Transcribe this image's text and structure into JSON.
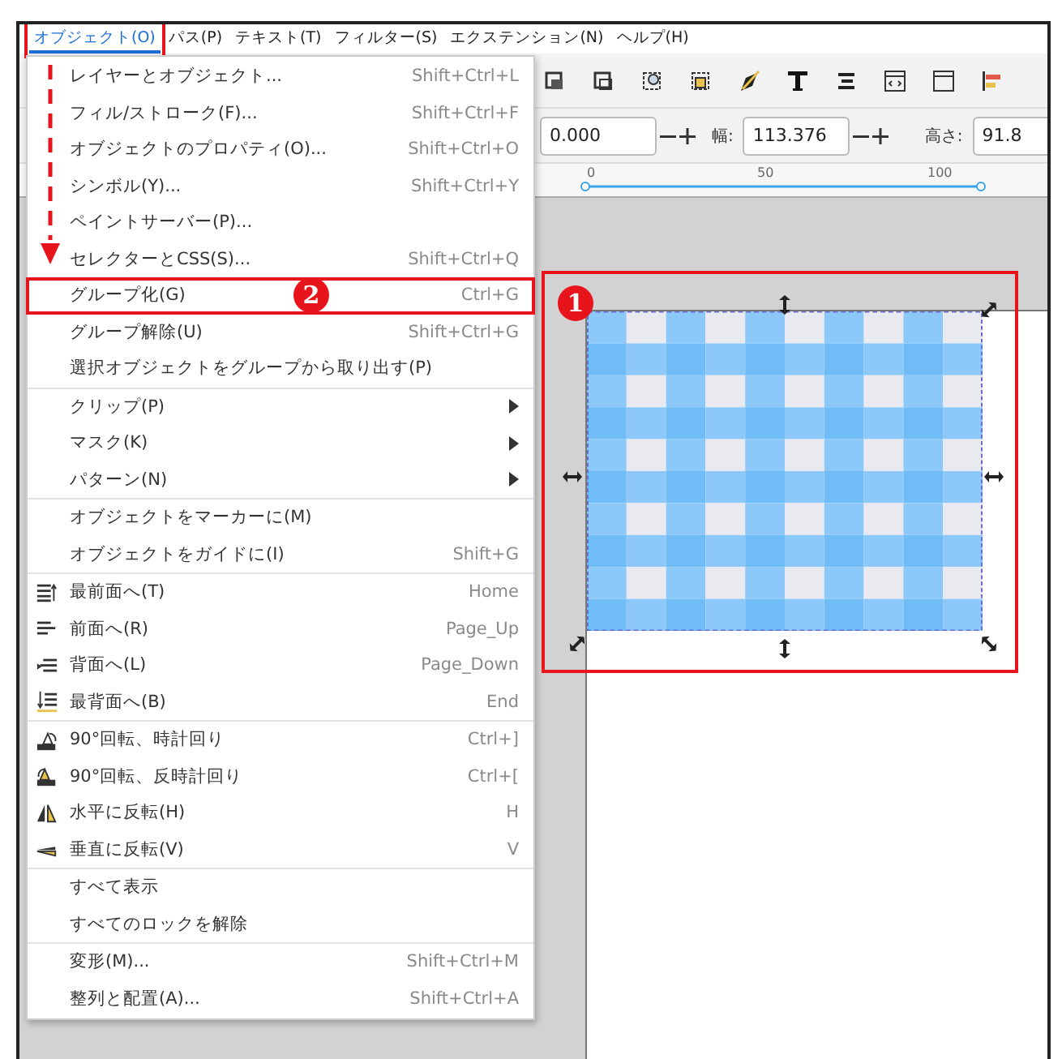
{
  "menubar": [
    {
      "label": "オブジェクト(O)",
      "selected": true,
      "callout": true
    },
    {
      "label": "パス(P)",
      "selected": false,
      "callout": false
    },
    {
      "label": "テキスト(T)",
      "selected": false,
      "callout": false
    },
    {
      "label": "フィルター(S)",
      "selected": false,
      "callout": false
    },
    {
      "label": "エクステンション(N)",
      "selected": false,
      "callout": false
    },
    {
      "label": "ヘルプ(H)",
      "selected": false,
      "callout": false
    }
  ],
  "toolbar": {
    "x_value": "0.000",
    "width_label": "幅:",
    "width_value": "113.376",
    "height_label": "高さ:",
    "height_value": "91.8"
  },
  "ruler": {
    "labels": [
      "0",
      "50",
      "100"
    ]
  },
  "menu": {
    "sections": [
      [
        {
          "kind": "plain",
          "label": "レイヤーとオブジェクト...",
          "shortcut": "Shift+Ctrl+L",
          "marked": false
        },
        {
          "kind": "plain",
          "label": "フィル/ストローク(F)...",
          "shortcut": "Shift+Ctrl+F",
          "marked": false
        },
        {
          "kind": "plain",
          "label": "オブジェクトのプロパティ(O)...",
          "shortcut": "Shift+Ctrl+O",
          "marked": false
        },
        {
          "kind": "plain",
          "label": "シンボル(Y)...",
          "shortcut": "Shift+Ctrl+Y",
          "marked": false
        },
        {
          "kind": "plain",
          "label": "ペイントサーバー(P)...",
          "marked": false
        },
        {
          "kind": "plain",
          "label": "セレクターとCSS(S)...",
          "shortcut": "Shift+Ctrl+Q",
          "marked": false
        },
        {
          "kind": "plain",
          "label": "グループ化(G)",
          "shortcut": "Ctrl+G",
          "marked": true
        },
        {
          "kind": "plain",
          "label": "グループ解除(U)",
          "shortcut": "Shift+Ctrl+G",
          "marked": false
        },
        {
          "kind": "plain",
          "label": "選択オブジェクトをグループから取り出す(P)",
          "marked": false
        }
      ],
      [
        {
          "kind": "submenu",
          "label": "クリップ(P)",
          "marked": false
        },
        {
          "kind": "submenu",
          "label": "マスク(K)",
          "marked": false
        },
        {
          "kind": "submenu",
          "label": "パターン(N)",
          "marked": false
        }
      ],
      [
        {
          "kind": "plain",
          "label": "オブジェクトをマーカーに(M)",
          "marked": false
        },
        {
          "kind": "plain",
          "label": "オブジェクトをガイドに(I)",
          "shortcut": "Shift+G",
          "marked": false
        }
      ],
      [
        {
          "kind": "icon",
          "label": "最前面へ(T)",
          "shortcut": "Home",
          "marked": false
        },
        {
          "kind": "icon",
          "label": "前面へ(R)",
          "shortcut": "Page_Up",
          "marked": false
        },
        {
          "kind": "icon",
          "label": "背面へ(L)",
          "shortcut": "Page_Down",
          "marked": false
        },
        {
          "kind": "icon",
          "label": "最背面へ(B)",
          "shortcut": "End",
          "marked": false
        }
      ],
      [
        {
          "kind": "icon",
          "label": "90°回転、時計回り",
          "shortcut": "Ctrl+]",
          "marked": false
        },
        {
          "kind": "icon",
          "label": "90°回転、反時計回り",
          "shortcut": "Ctrl+[",
          "marked": false
        },
        {
          "kind": "icon",
          "label": "水平に反転(H)",
          "shortcut": "H",
          "marked": false
        },
        {
          "kind": "icon",
          "label": "垂直に反転(V)",
          "shortcut": "V",
          "marked": false
        }
      ],
      [
        {
          "kind": "plain",
          "label": "すべて表示",
          "marked": false
        },
        {
          "kind": "plain",
          "label": "すべてのロックを解除",
          "marked": false
        }
      ],
      [
        {
          "kind": "plain",
          "label": "変形(M)...",
          "shortcut": "Shift+Ctrl+M",
          "marked": false
        },
        {
          "kind": "plain",
          "label": "整列と配置(A)...",
          "shortcut": "Shift+Ctrl+A",
          "marked": false
        }
      ]
    ]
  },
  "callouts": {
    "canvas": "1",
    "menu_item": "2"
  }
}
